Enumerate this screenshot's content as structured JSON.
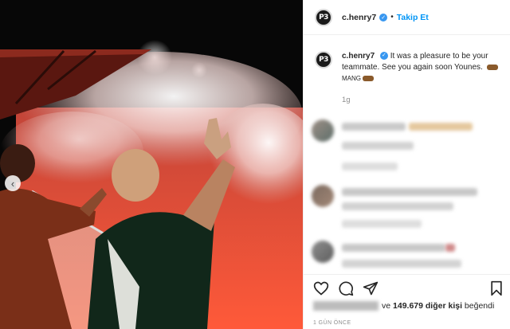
{
  "post": {
    "username": "c.henry7",
    "avatar_text": "P3",
    "follow_label": "Takip Et",
    "separator": "•",
    "verified_icon": "verified-badge-icon",
    "caption_prefix": "It was a pleasure to be your teammate. See you again soon Younes.",
    "caption_word": "MANG",
    "time_ago_short": "1g",
    "likes_text": "ve",
    "likes_count": "149.679 diğer kişi",
    "likes_suffix": "beğendi",
    "date_label": "1 GÜN ÖNCE",
    "carousel_prev": "‹"
  },
  "icons": [
    "heart-icon",
    "comment-icon",
    "share-icon",
    "bookmark-icon",
    "chevron-left-icon"
  ],
  "colors": {
    "accent": "#0095f6",
    "verified": "#3897f0",
    "text": "#262626",
    "muted": "#8e8e8e"
  }
}
